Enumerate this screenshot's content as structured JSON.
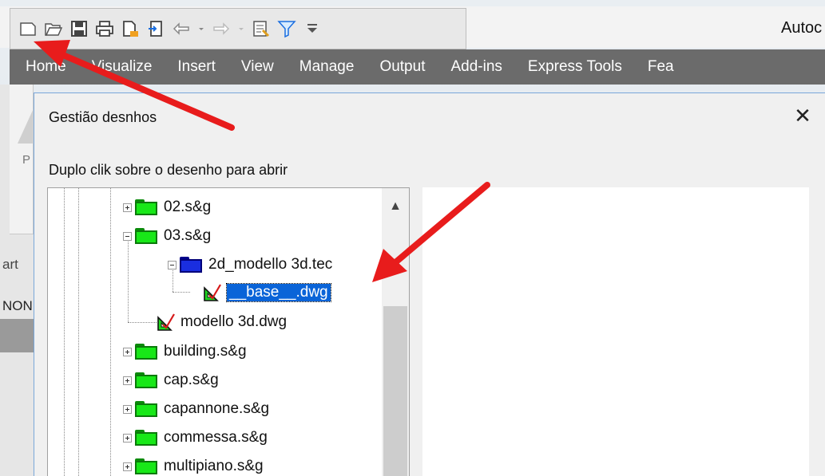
{
  "app": {
    "title": "Autoc"
  },
  "quick_access": {
    "icons": [
      "new-icon",
      "open-icon",
      "save-icon",
      "print-icon",
      "publish-icon",
      "import-icon",
      "undo-icon",
      "redo-icon",
      "properties-icon",
      "filter-icon",
      "customize-icon"
    ]
  },
  "ribbon": {
    "tabs": [
      "Home",
      "Visualize",
      "Insert",
      "View",
      "Manage",
      "Output",
      "Add-ins",
      "Express Tools",
      "Fea"
    ]
  },
  "left_panel": {
    "p": "P",
    "art": "art",
    "non": "NON"
  },
  "dialog": {
    "title": "Gestião desnhos",
    "close": "✕",
    "instruction": "Duplo clik sobre o desenho para abrir",
    "tree": {
      "items": [
        {
          "label": "02.s&g"
        },
        {
          "label": "03.s&g"
        },
        {
          "label": "2d_modello 3d.tec"
        },
        {
          "label": "__base__.dwg"
        },
        {
          "label": "modello 3d.dwg"
        },
        {
          "label": "building.s&g"
        },
        {
          "label": "cap.s&g"
        },
        {
          "label": "capannone.s&g"
        },
        {
          "label": "commessa.s&g"
        },
        {
          "label": "multipiano.s&g"
        }
      ],
      "scroll_up": "▲"
    }
  },
  "colors": {
    "annotation_arrow": "#e81c1c",
    "selection": "#0a64d8",
    "folder": "#18e818",
    "folder_tec": "#1a2ee0",
    "ribbon_tabs": "#6b6b6b"
  }
}
